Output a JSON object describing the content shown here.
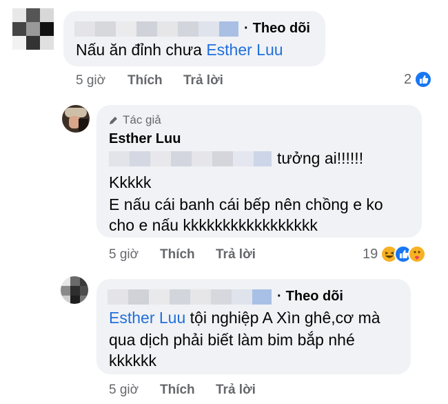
{
  "comments": [
    {
      "follow_label": "Theo dõi",
      "text": "Nấu ăn đỉnh chưa",
      "mention": "Esther Luu",
      "time": "5 giờ",
      "like_label": "Thích",
      "reply_label": "Trả lời",
      "reaction_count": "2",
      "reactions": [
        "like-icon"
      ]
    },
    {
      "author_tag": "Tác giả",
      "name": "Esther Luu",
      "line1_suffix": "tưởng ai!!!!!!",
      "line2": "Kkkkk",
      "line3": "E nấu cái banh cái bếp nên chồng e ko",
      "line4": "cho e nấu kkkkkkkkkkkkkkkkk",
      "time": "5 giờ",
      "like_label": "Thích",
      "reply_label": "Trả lời",
      "reaction_count": "19",
      "reactions": [
        "haha-icon",
        "like-icon",
        "care-icon"
      ]
    },
    {
      "follow_label": "Theo dõi",
      "mention": "Esther Luu",
      "line1_suffix": "tội nghiệp A Xìn ghê,cơ mà",
      "line2": "qua dịch phải biết làm bim bắp nhé",
      "line3": "kkkkkk",
      "time": "5 giờ",
      "like_label": "Thích",
      "reply_label": "Trả lời"
    }
  ],
  "colors": {
    "bubble": "#f0f2f5",
    "mention": "#216fdb",
    "meta": "#65676b",
    "like": "#1877f2",
    "haha": "#f7b125"
  }
}
